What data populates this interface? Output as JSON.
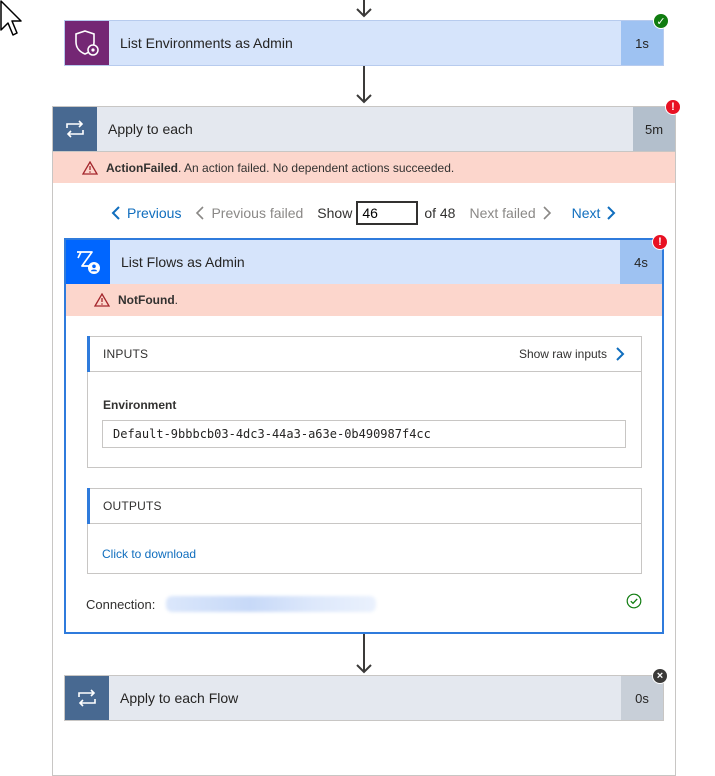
{
  "actions": {
    "list_environments": {
      "title": "List Environments as Admin",
      "duration": "1s",
      "status": "succeeded",
      "icon": "shield-gear-icon",
      "icon_bg": "#742774"
    },
    "apply_to_each": {
      "title": "Apply to each",
      "duration": "5m",
      "status": "failed",
      "icon": "loop-icon",
      "icon_bg": "#486991",
      "error_code": "ActionFailed",
      "error_message": ". An action failed. No dependent actions succeeded."
    },
    "list_flows": {
      "title": "List Flows as Admin",
      "duration": "4s",
      "status": "failed",
      "icon": "flow-admin-icon",
      "icon_bg": "#0066ff",
      "error_code": "NotFound",
      "error_message": ".",
      "inputs": {
        "heading": "INPUTS",
        "show_raw": "Show raw inputs",
        "environment_label": "Environment",
        "environment_value": "Default-9bbbcb03-4dc3-44a3-a63e-0b490987f4cc"
      },
      "outputs": {
        "heading": "OUTPUTS",
        "download_link": "Click to download"
      },
      "connection_label": "Connection:"
    },
    "apply_to_each_flow": {
      "title": "Apply to each Flow",
      "duration": "0s",
      "status": "skipped",
      "icon": "loop-icon",
      "icon_bg": "#486991"
    }
  },
  "pager": {
    "previous": "Previous",
    "previous_failed": "Previous failed",
    "show_label": "Show",
    "current": "46",
    "of_total": "of 48",
    "next_failed": "Next failed",
    "next": "Next"
  },
  "colors": {
    "success": "#107c10",
    "error": "#e81123",
    "skipped": "#605e5c",
    "link": "#106ebe",
    "error_banner": "#fcd6cc",
    "selected_border": "#2f7bdc"
  }
}
